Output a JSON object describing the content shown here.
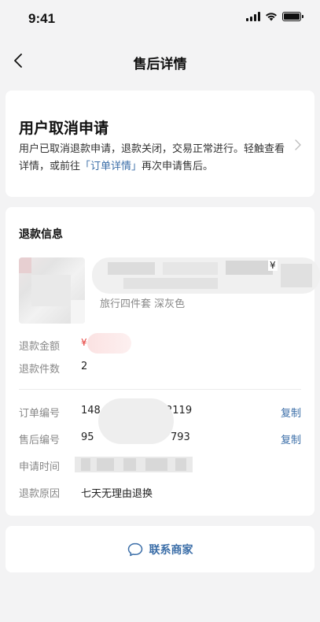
{
  "status_bar": {
    "time": "9:41"
  },
  "nav": {
    "title": "售后详情"
  },
  "status_card": {
    "title": "用户取消申请",
    "desc_before": "用户已取消退款申请，退款关闭，交易正常进行。轻触查看详情，或前往",
    "desc_link": "「订单详情」",
    "desc_after": "再次申请售后。"
  },
  "refund_info": {
    "section_title": "退款信息",
    "product": {
      "price_symbol": "¥",
      "spec": "旅行四件套 深灰色"
    },
    "amount_label": "退款金额",
    "amount_symbol": "¥",
    "count_label": "退款件数",
    "count_value": "2",
    "order_no_label": "订单编号",
    "order_no_prefix": "148",
    "order_no_suffix": "2119",
    "aftersale_no_label": "售后编号",
    "aftersale_no_prefix": "95",
    "aftersale_no_suffix": "793",
    "apply_time_label": "申请时间",
    "reason_label": "退款原因",
    "reason_value": "七天无理由退换",
    "copy_label": "复制"
  },
  "contact": {
    "label": "联系商家"
  },
  "colors": {
    "link": "#3b6ea8",
    "price": "#e53935",
    "background": "#f3f3f4"
  }
}
